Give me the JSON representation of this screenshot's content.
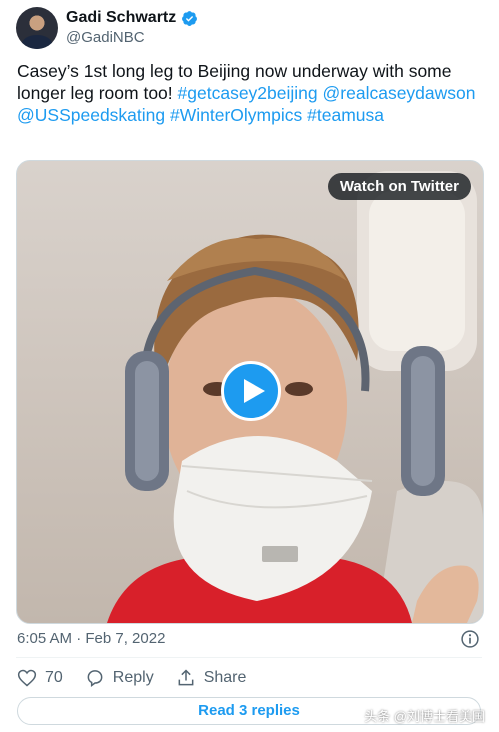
{
  "author": {
    "display_name": "Gadi Schwartz",
    "handle": "@GadiNBC",
    "verified_icon": "verified-badge-icon"
  },
  "tweet": {
    "text_plain": "Casey’s 1st long leg to Beijing now underway with some longer leg room too!",
    "hashtag_1": "#getcasey2beijing",
    "mention_1": "@realcaseydawson",
    "mention_2": "@USSpeedskating",
    "hashtag_2": "#WinterOlympics",
    "hashtag_3": "#teamusa"
  },
  "media": {
    "watch_label": "Watch on Twitter",
    "play_icon": "play-icon"
  },
  "meta": {
    "timestamp": "6:05 AM · Feb 7, 2022",
    "info_icon": "info-icon"
  },
  "actions": {
    "like_count": "70",
    "reply_label": "Reply",
    "share_label": "Share"
  },
  "read_replies_label": "Read 3 replies",
  "watermark": "头条 @刘博士看美国",
  "colors": {
    "accent": "#1d9bf0",
    "text": "#0f1419",
    "muted": "#536471"
  }
}
